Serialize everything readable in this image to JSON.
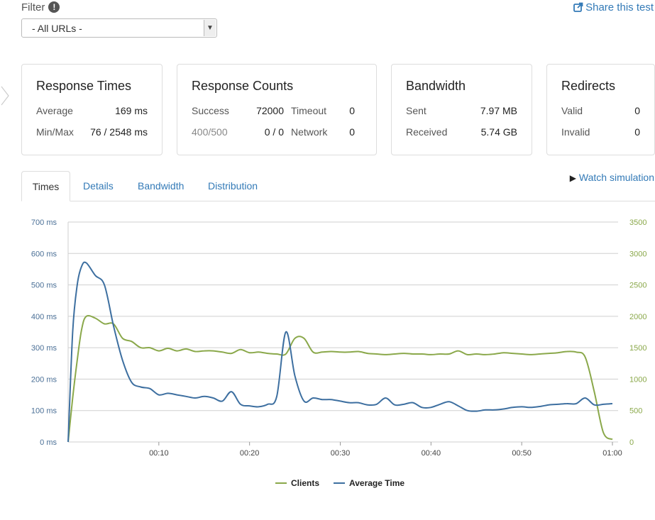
{
  "filter": {
    "label": "Filter",
    "info_icon": "!",
    "selected": "- All URLs -"
  },
  "share": {
    "label": "Share this test",
    "icon": "share-icon"
  },
  "cards": {
    "response_times": {
      "title": "Response Times",
      "average_label": "Average",
      "average_value": "169 ms",
      "minmax_label": "Min/Max",
      "minmax_value": "76 / 2548 ms"
    },
    "response_counts": {
      "title": "Response Counts",
      "success_label": "Success",
      "success_value": "72000",
      "timeout_label": "Timeout",
      "timeout_value": "0",
      "errors_label": "400/500",
      "errors_value": "0 / 0",
      "network_label": "Network",
      "network_value": "0"
    },
    "bandwidth": {
      "title": "Bandwidth",
      "sent_label": "Sent",
      "sent_value": "7.97 MB",
      "received_label": "Received",
      "received_value": "5.74 GB"
    },
    "redirects": {
      "title": "Redirects",
      "valid_label": "Valid",
      "valid_value": "0",
      "invalid_label": "Invalid",
      "invalid_value": "0"
    }
  },
  "tabs": [
    "Times",
    "Details",
    "Bandwidth",
    "Distribution"
  ],
  "watch_simulation": "Watch simulation",
  "colors": {
    "clients": "#8aa84a",
    "average_time": "#3d6fa0",
    "left_axis": "#4a6f96",
    "right_axis": "#8aa84a",
    "link": "#337ab7"
  },
  "chart_data": {
    "type": "line",
    "x_ticks": [
      "00:10",
      "00:20",
      "00:30",
      "00:40",
      "00:50",
      "01:00"
    ],
    "x_range_seconds": [
      0,
      60
    ],
    "y_left": {
      "ticks": [
        "0 ms",
        "100 ms",
        "200 ms",
        "300 ms",
        "400 ms",
        "500 ms",
        "600 ms",
        "700 ms"
      ],
      "range": [
        0,
        700
      ]
    },
    "y_right": {
      "ticks": [
        "0",
        "500",
        "1000",
        "1500",
        "2000",
        "2500",
        "3000",
        "3500"
      ],
      "range": [
        0,
        3500
      ]
    },
    "legend": [
      "Clients",
      "Average Time"
    ],
    "series": [
      {
        "name": "Clients",
        "axis": "right",
        "x": [
          0,
          0.5,
          1,
          1.5,
          2,
          3,
          4,
          5,
          6,
          7,
          8,
          9,
          10,
          11,
          12,
          13,
          14,
          15,
          16,
          17,
          18,
          19,
          20,
          21,
          22,
          23,
          24,
          25,
          26,
          27,
          28,
          29,
          30,
          31,
          32,
          33,
          34,
          35,
          36,
          37,
          38,
          39,
          40,
          41,
          42,
          43,
          44,
          45,
          46,
          47,
          48,
          49,
          50,
          51,
          52,
          53,
          54,
          55,
          56,
          57,
          58,
          59,
          60
        ],
        "y": [
          0,
          700,
          1300,
          1800,
          2000,
          1970,
          1880,
          1880,
          1650,
          1600,
          1500,
          1500,
          1450,
          1490,
          1450,
          1480,
          1440,
          1450,
          1450,
          1430,
          1410,
          1470,
          1420,
          1430,
          1410,
          1400,
          1400,
          1650,
          1650,
          1430,
          1430,
          1440,
          1430,
          1430,
          1440,
          1410,
          1400,
          1390,
          1400,
          1410,
          1400,
          1400,
          1390,
          1400,
          1400,
          1450,
          1390,
          1400,
          1390,
          1400,
          1420,
          1410,
          1400,
          1390,
          1400,
          1410,
          1420,
          1440,
          1430,
          1350,
          800,
          150,
          40
        ]
      },
      {
        "name": "Average Time",
        "axis": "left",
        "x": [
          0,
          0.5,
          1,
          1.5,
          2,
          3,
          4,
          5,
          6,
          7,
          8,
          9,
          10,
          11,
          12,
          13,
          14,
          15,
          16,
          17,
          18,
          19,
          20,
          21,
          22,
          23,
          24,
          25,
          26,
          27,
          28,
          29,
          30,
          31,
          32,
          33,
          34,
          35,
          36,
          37,
          38,
          39,
          40,
          41,
          42,
          43,
          44,
          45,
          46,
          47,
          48,
          49,
          50,
          51,
          52,
          53,
          54,
          55,
          56,
          57,
          58,
          59,
          60
        ],
        "y": [
          0,
          350,
          500,
          560,
          570,
          530,
          500,
          370,
          260,
          190,
          175,
          170,
          150,
          155,
          150,
          145,
          140,
          145,
          140,
          130,
          160,
          120,
          115,
          112,
          120,
          145,
          350,
          210,
          130,
          140,
          135,
          135,
          130,
          125,
          125,
          118,
          120,
          140,
          118,
          120,
          125,
          110,
          110,
          120,
          128,
          115,
          100,
          98,
          102,
          102,
          105,
          110,
          112,
          110,
          113,
          118,
          120,
          122,
          122,
          140,
          118,
          120,
          122
        ]
      }
    ]
  }
}
